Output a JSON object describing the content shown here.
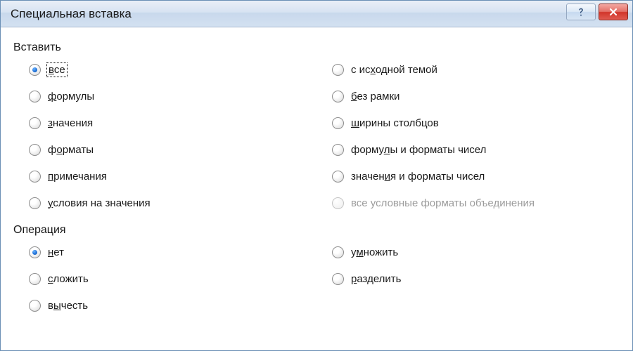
{
  "title": "Специальная вставка",
  "paste_group": {
    "label": "Вставить",
    "col1": [
      {
        "text": "все",
        "checked": true,
        "focused": true,
        "underline_char": "в"
      },
      {
        "text": "формулы",
        "underline_char": "ф"
      },
      {
        "text": "значения",
        "underline_char": "з"
      },
      {
        "text": "форматы",
        "underline_char": "о"
      },
      {
        "text": "примечания",
        "underline_char": "п"
      },
      {
        "text": "условия на значения",
        "underline_char": "у"
      }
    ],
    "col2": [
      {
        "text": "с исходной темой",
        "underline_char": "х"
      },
      {
        "text": "без рамки",
        "underline_char": "б"
      },
      {
        "text": "ширины столбцов",
        "underline_char": "ш"
      },
      {
        "text": "формулы и форматы чисел",
        "underline_char": "л"
      },
      {
        "text": "значения и форматы чисел",
        "underline_char": "и"
      },
      {
        "text": "все условные форматы объединения",
        "disabled": true
      }
    ]
  },
  "operation_group": {
    "label": "Операция",
    "col1": [
      {
        "text": "нет",
        "checked": true,
        "underline_char": "н"
      },
      {
        "text": "сложить",
        "underline_char": "с"
      },
      {
        "text": "вычесть",
        "underline_char": "ы"
      }
    ],
    "col2": [
      {
        "text": "умножить",
        "underline_char": "м"
      },
      {
        "text": "разделить",
        "underline_char": "р"
      }
    ]
  }
}
